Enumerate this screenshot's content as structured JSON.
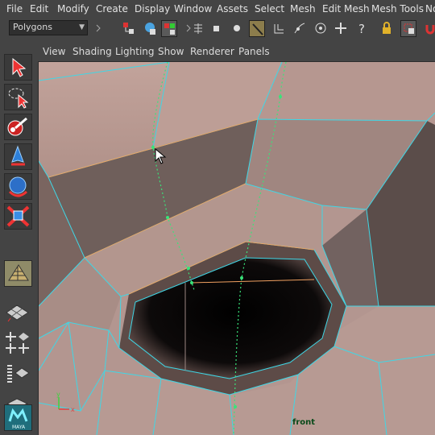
{
  "menus": [
    "File",
    "Edit",
    "Modify",
    "Create",
    "Display",
    "Window",
    "Assets",
    "Select",
    "Mesh",
    "Edit Mesh",
    "Mesh Tools",
    "No"
  ],
  "status_line": {
    "mode_selector": "Polygons",
    "icons": [
      "chevron-right-icon",
      "select-hierarchy-icon",
      "select-object-icon",
      "select-component-icon",
      "chevron-right-icon",
      "snap-grid-icon",
      "snap-square-icon",
      "snap-circle-icon",
      "snap-curve-icon",
      "snap-point-icon",
      "snap-line-icon",
      "snap-view-icon",
      "move-cross-icon",
      "help-question-icon",
      "lock-icon",
      "select-box-icon",
      "magnet-icon"
    ]
  },
  "toolbox": [
    "select-arrow-icon",
    "lasso-select-icon",
    "paint-select-icon",
    "move-tool-icon",
    "rotate-tool-icon",
    "scale-tool-icon",
    "last-tool-icon",
    "single-perspective-layout-icon",
    "four-view-layout-icon",
    "outliner-layout-icon",
    "persp-outliner-layout-icon",
    "maya-logo-icon"
  ],
  "panel_menu": [
    "View",
    "Shading",
    "Lighting",
    "Show",
    "Renderer",
    "Panels"
  ],
  "viewport": {
    "camera_label": "front",
    "logo_text": "MAYA",
    "colors": {
      "mesh_surface": "#b59a92",
      "wireframe": "#3fd7e6",
      "selected_edge": "#f0a060",
      "guide_points": "#39e37a",
      "background": "#444444"
    }
  }
}
